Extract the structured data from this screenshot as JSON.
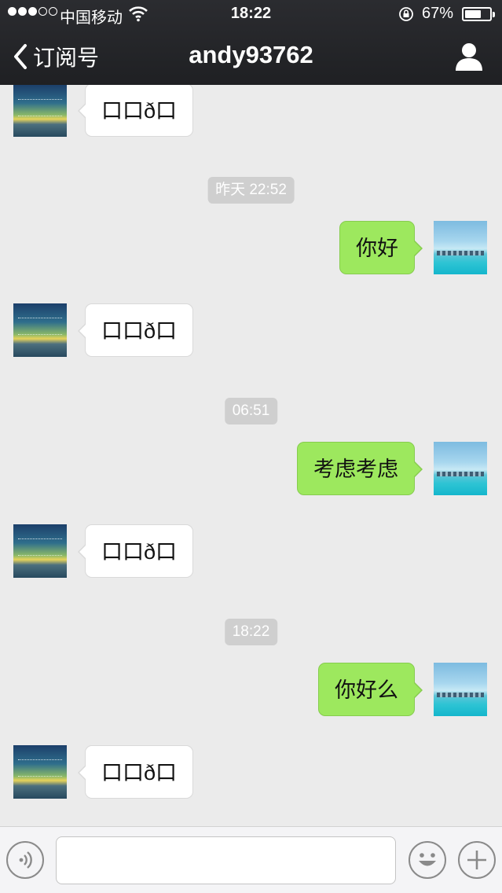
{
  "status_bar": {
    "carrier": "中国移动",
    "time": "18:22",
    "battery_percent_label": "67%",
    "battery_level": 0.67,
    "signal_bars": 3,
    "signal_total": 5
  },
  "nav": {
    "back_label": "订阅号",
    "title": "andy93762"
  },
  "messages": [
    {
      "kind": "message",
      "side": "left",
      "text": "口口ð口",
      "avatar": "sunset-avatar"
    },
    {
      "kind": "timestamp",
      "text": "昨天 22:52"
    },
    {
      "kind": "message",
      "side": "right",
      "text": "你好",
      "avatar": "sea-avatar"
    },
    {
      "kind": "message",
      "side": "left",
      "text": "口口ð口",
      "avatar": "sunset-avatar"
    },
    {
      "kind": "timestamp",
      "text": "06:51"
    },
    {
      "kind": "message",
      "side": "right",
      "text": "考虑考虑",
      "avatar": "sea-avatar"
    },
    {
      "kind": "message",
      "side": "left",
      "text": "口口ð口",
      "avatar": "sunset-avatar"
    },
    {
      "kind": "timestamp",
      "text": "18:22"
    },
    {
      "kind": "message",
      "side": "right",
      "text": "你好么",
      "avatar": "sea-avatar"
    },
    {
      "kind": "message",
      "side": "left",
      "text": "口口ð口",
      "avatar": "sunset-avatar"
    }
  ],
  "input_bar": {
    "text_value": "",
    "icons": [
      "voice-icon",
      "emoji-icon",
      "plus-icon"
    ]
  },
  "colors": {
    "nav_background": "#1f2023",
    "chat_background": "#ebebeb",
    "outgoing_bubble": "#9de85e",
    "incoming_bubble": "#ffffff",
    "timestamp_pill": "#cfcfcf"
  }
}
